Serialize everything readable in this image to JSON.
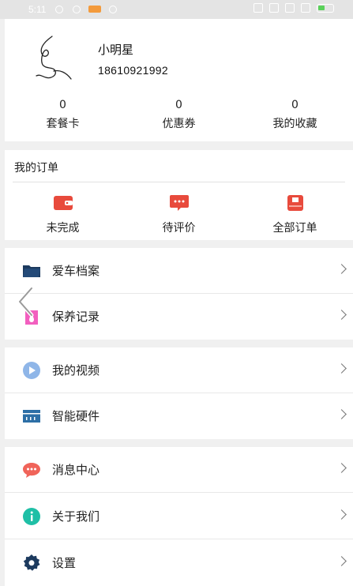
{
  "status_bar": {
    "time": "5:11"
  },
  "profile": {
    "username": "小明星",
    "phone": "18610921992",
    "stats": [
      {
        "value": "0",
        "label": "套餐卡"
      },
      {
        "value": "0",
        "label": "优惠券"
      },
      {
        "value": "0",
        "label": "我的收藏"
      }
    ]
  },
  "orders": {
    "title": "我的订单",
    "items": [
      {
        "label": "未完成",
        "icon": "wallet-icon"
      },
      {
        "label": "待评价",
        "icon": "comment-icon"
      },
      {
        "label": "全部订单",
        "icon": "order-box-icon"
      }
    ]
  },
  "menu_group_1": [
    {
      "label": "爱车档案",
      "icon": "folder-icon"
    },
    {
      "label": "保养记录",
      "icon": "maintenance-icon"
    }
  ],
  "menu_group_2": [
    {
      "label": "我的视频",
      "icon": "video-play-icon"
    },
    {
      "label": "智能硬件",
      "icon": "hardware-icon"
    }
  ],
  "menu_group_3": [
    {
      "label": "消息中心",
      "icon": "message-icon"
    },
    {
      "label": "关于我们",
      "icon": "info-icon"
    },
    {
      "label": "设置",
      "icon": "settings-gear-icon"
    }
  ],
  "colors": {
    "accent_red": "#e84a3c",
    "folder_blue": "#1c3a5e",
    "video_blue": "#8fb6e8",
    "hardware_blue": "#2d6fa6",
    "message_red": "#f0645a",
    "info_teal": "#1fbfa6",
    "maintenance_pink": "#f25fbf"
  }
}
